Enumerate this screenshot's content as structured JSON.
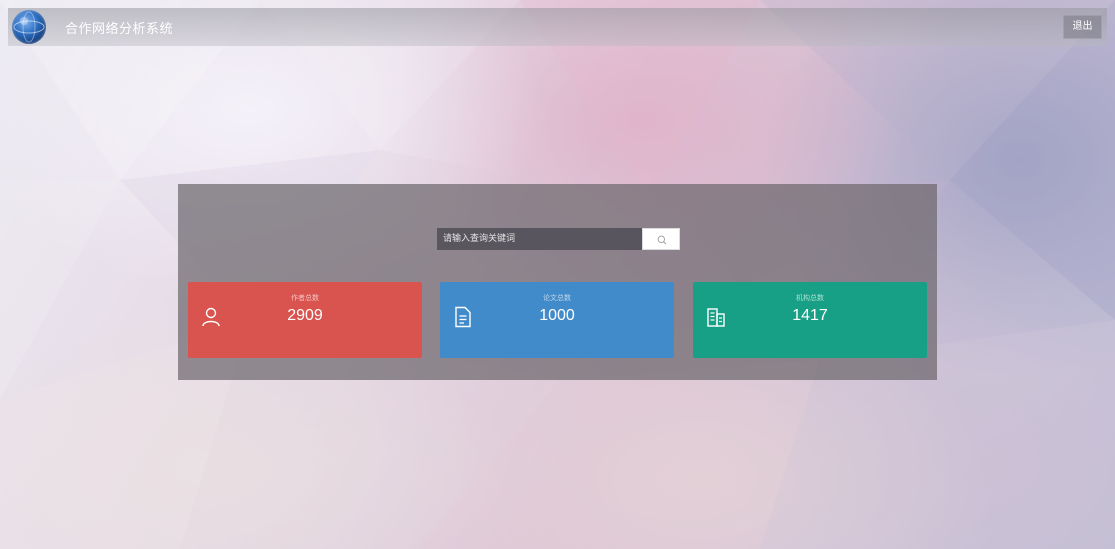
{
  "header": {
    "title": "合作网络分析系统",
    "logout_label": "退出"
  },
  "search": {
    "placeholder": "请输入查询关键词"
  },
  "stats": [
    {
      "label": "作者总数",
      "value": "2909",
      "icon": "user-icon",
      "color": "#d9534f"
    },
    {
      "label": "论文总数",
      "value": "1000",
      "icon": "document-icon",
      "color": "#428bca"
    },
    {
      "label": "机构总数",
      "value": "1417",
      "icon": "building-icon",
      "color": "#17a085"
    }
  ]
}
